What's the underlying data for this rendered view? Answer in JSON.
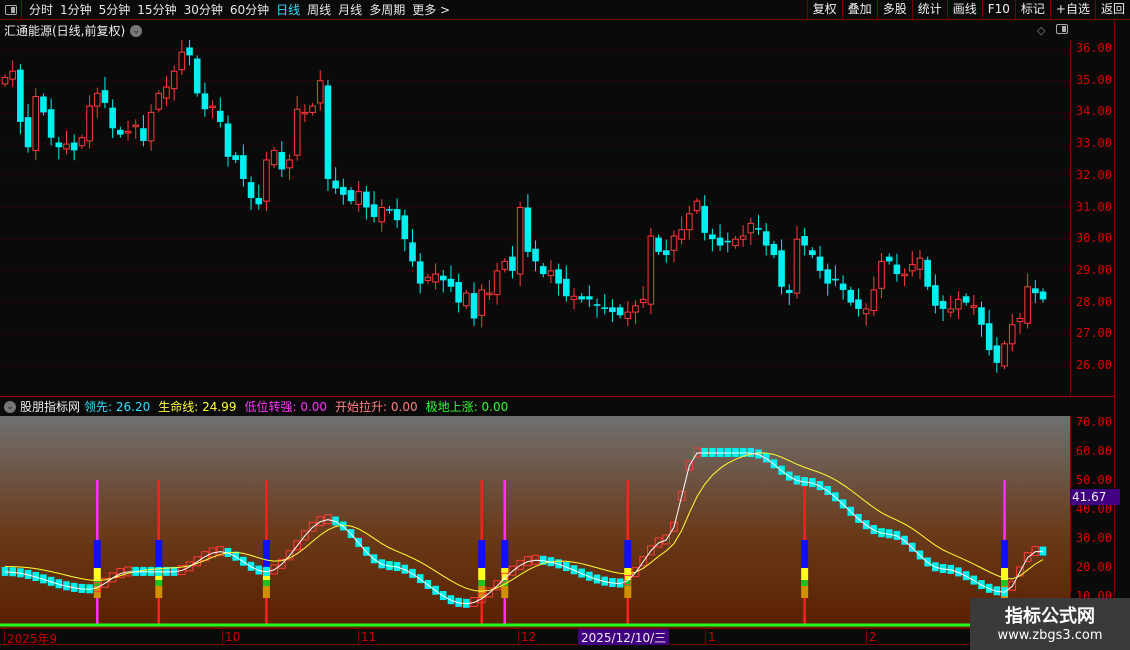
{
  "toolbar": {
    "periods": [
      "分时",
      "1分钟",
      "5分钟",
      "15分钟",
      "30分钟",
      "60分钟",
      "日线",
      "周线",
      "月线",
      "多周期",
      "更多 >"
    ],
    "active": "日线",
    "right_buttons": [
      "复权",
      "叠加",
      "多股",
      "统计",
      "画线",
      "F10",
      "标记",
      "+自选",
      "返回"
    ]
  },
  "main": {
    "title": "汇通能源(日线,前复权)",
    "price_ticks": [
      "36.00",
      "35.00",
      "34.00",
      "33.00",
      "32.00",
      "31.00",
      "30.00",
      "29.00",
      "28.00",
      "27.00",
      "26.00"
    ]
  },
  "indicator": {
    "name": "股朋指标网",
    "fields": [
      {
        "label": "领先:",
        "value": "26.20",
        "color": "#2fe0ff"
      },
      {
        "label": "生命线:",
        "value": "24.99",
        "color": "#ffff30"
      },
      {
        "label": "低位转强:",
        "value": "0.00",
        "color": "#ff30ff"
      },
      {
        "label": "开始拉升:",
        "value": "0.00",
        "color": "#ff8080"
      },
      {
        "label": "极地上涨:",
        "value": "0.00",
        "color": "#30ff30"
      }
    ],
    "ticks": [
      "70.00",
      "60.00",
      "50.00",
      "40.00",
      "30.00",
      "20.00",
      "10.00"
    ],
    "current_value": "41.67"
  },
  "dates": {
    "labels": [
      "2025年9",
      "10",
      "11",
      "12",
      "1",
      "2"
    ],
    "selected": "2025/12/10/三"
  },
  "watermark": {
    "line1": "指标公式网",
    "line2": "www.zbgs3.com"
  },
  "colors": {
    "up": "#ff3a3a",
    "down": "#00f0f0"
  },
  "chart_data": {
    "type": "candlestick",
    "ylim": [
      25.5,
      36.6
    ],
    "closes": [
      35.1,
      35.3,
      33.7,
      32.9,
      34.5,
      34.0,
      33.2,
      32.9,
      33.0,
      32.8,
      33.2,
      34.2,
      34.6,
      34.3,
      33.5,
      33.3,
      33.4,
      33.6,
      33.1,
      34.0,
      34.6,
      34.8,
      35.3,
      35.9,
      35.8,
      34.6,
      34.1,
      34.2,
      33.7,
      32.6,
      32.5,
      31.9,
      31.3,
      31.1,
      32.5,
      32.8,
      32.2,
      32.5,
      34.1,
      34.0,
      34.2,
      35.0,
      31.9,
      31.6,
      31.4,
      31.2,
      31.5,
      31.0,
      30.7,
      31.0,
      30.9,
      30.6,
      30.0,
      29.3,
      28.6,
      28.8,
      28.9,
      28.7,
      28.5,
      28.0,
      28.3,
      27.5,
      28.4,
      28.3,
      29.0,
      29.3,
      29.0,
      31.0,
      29.6,
      29.3,
      28.9,
      29.0,
      28.6,
      28.2,
      28.2,
      28.1,
      28.1,
      27.9,
      27.8,
      27.7,
      27.6,
      27.7,
      27.9,
      28.1,
      30.1,
      29.6,
      29.5,
      30.1,
      30.3,
      30.8,
      31.2,
      30.2,
      30.0,
      29.8,
      29.9,
      30.0,
      30.1,
      30.5,
      30.3,
      29.8,
      29.5,
      28.5,
      28.3,
      30.0,
      29.8,
      29.5,
      29.0,
      28.6,
      28.7,
      28.4,
      28.0,
      27.8,
      27.8,
      28.4,
      29.3,
      29.3,
      28.9,
      28.9,
      29.2,
      29.4,
      28.5,
      27.9,
      27.8,
      27.8,
      28.1,
      28.0,
      27.9,
      27.3,
      26.5,
      26.1,
      26.7,
      27.3,
      27.5,
      28.5,
      28.3,
      28.1
    ],
    "indicator_keypoints": [
      [
        0,
        19
      ],
      [
        11,
        13
      ],
      [
        16,
        19
      ],
      [
        22,
        19
      ],
      [
        28,
        26
      ],
      [
        34,
        19
      ],
      [
        42,
        37
      ],
      [
        50,
        21
      ],
      [
        60,
        8
      ],
      [
        69,
        23
      ],
      [
        80,
        15
      ],
      [
        86,
        30
      ],
      [
        90,
        60
      ],
      [
        97,
        60
      ],
      [
        104,
        50
      ],
      [
        115,
        32
      ],
      [
        122,
        20
      ],
      [
        130,
        12
      ],
      [
        134,
        26
      ]
    ],
    "signal_indices": [
      12,
      20,
      34,
      62,
      65,
      81,
      104,
      130
    ],
    "indicator_ylim": [
      5,
      75
    ]
  }
}
